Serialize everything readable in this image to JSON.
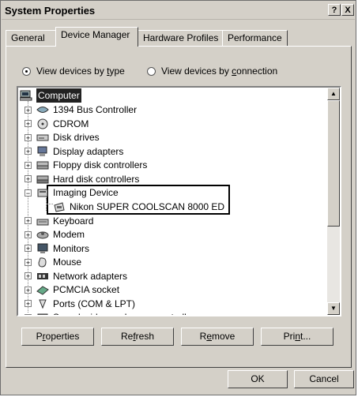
{
  "window": {
    "title": "System Properties",
    "help_button": "?",
    "close_button": "X"
  },
  "tabs": [
    {
      "label": "General",
      "active": false
    },
    {
      "label": "Device Manager",
      "active": true
    },
    {
      "label": "Hardware Profiles",
      "active": false
    },
    {
      "label": "Performance",
      "active": false
    }
  ],
  "view_options": {
    "by_type": {
      "prefix": "View devices by ",
      "underlined": "t",
      "suffix": "ype",
      "selected": true
    },
    "by_connection": {
      "prefix": "View devices by ",
      "underlined": "c",
      "suffix": "onnection",
      "selected": false
    }
  },
  "tree": {
    "root": "Computer",
    "items": [
      {
        "label": "1394 Bus Controller",
        "icon": "bus-controller-icon"
      },
      {
        "label": "CDROM",
        "icon": "cdrom-icon"
      },
      {
        "label": "Disk drives",
        "icon": "disk-drive-icon"
      },
      {
        "label": "Display adapters",
        "icon": "display-adapter-icon"
      },
      {
        "label": "Floppy disk controllers",
        "icon": "floppy-controller-icon"
      },
      {
        "label": "Hard disk controllers",
        "icon": "hard-disk-controller-icon"
      },
      {
        "label": "Imaging Device",
        "icon": "imaging-device-icon",
        "expanded": true
      },
      {
        "label": "Nikon SUPER COOLSCAN 8000 ED",
        "icon": "scanner-icon",
        "child": true
      },
      {
        "label": "Keyboard",
        "icon": "keyboard-icon"
      },
      {
        "label": "Modem",
        "icon": "modem-icon"
      },
      {
        "label": "Monitors",
        "icon": "monitor-icon"
      },
      {
        "label": "Mouse",
        "icon": "mouse-icon"
      },
      {
        "label": "Network adapters",
        "icon": "network-adapter-icon"
      },
      {
        "label": "PCMCIA socket",
        "icon": "pcmcia-icon"
      },
      {
        "label": "Ports (COM & LPT)",
        "icon": "ports-icon"
      },
      {
        "label": "Sound, video and game controllers",
        "icon": "sound-icon"
      }
    ]
  },
  "buttons": {
    "properties": {
      "pre": "P",
      "u": "r",
      "post": "operties"
    },
    "refresh": {
      "pre": "Re",
      "u": "f",
      "post": "resh"
    },
    "remove": {
      "pre": "R",
      "u": "e",
      "post": "move"
    },
    "print": {
      "pre": "Pri",
      "u": "n",
      "post": "t..."
    },
    "ok": "OK",
    "cancel": "Cancel"
  }
}
